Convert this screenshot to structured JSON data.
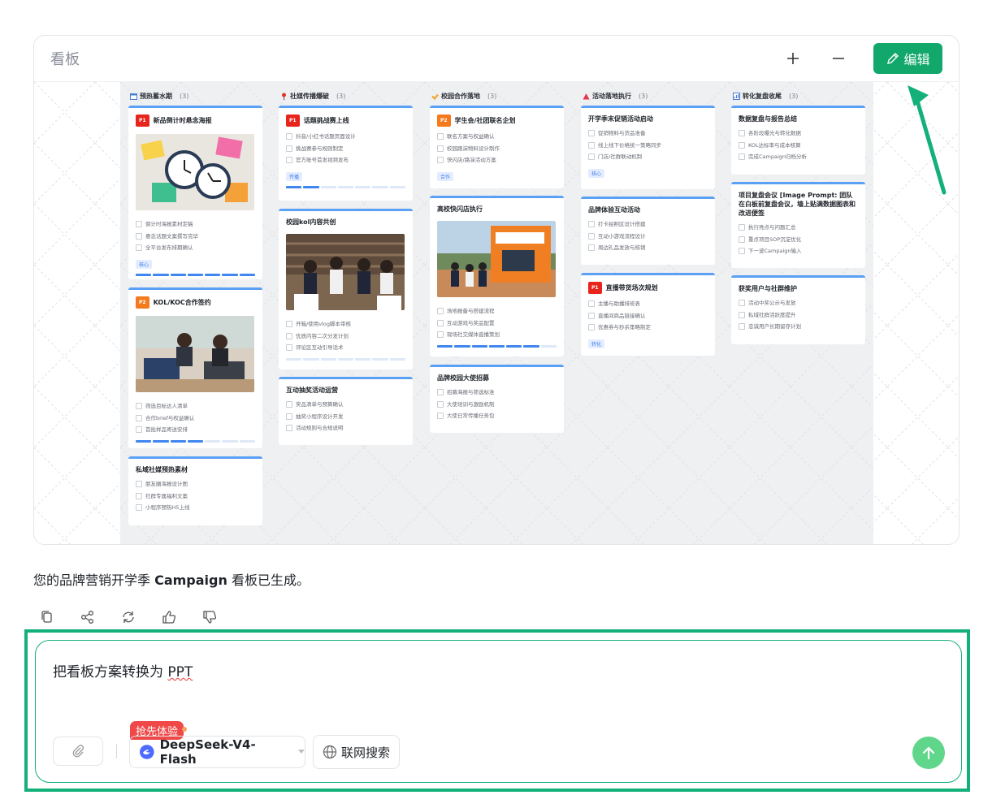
{
  "panel": {
    "title": "看板",
    "plus_icon": "plus-icon",
    "minus_icon": "minus-icon",
    "edit_label": "编辑"
  },
  "columns": [
    {
      "icon": "calendar-icon",
      "title": "预热蓄水期",
      "count": "(3)"
    },
    {
      "icon": "pin-icon",
      "title": "社媒传播爆破",
      "count": "(3)"
    },
    {
      "icon": "handshake-icon",
      "title": "校园合作落地",
      "count": "(3)"
    },
    {
      "icon": "tent-icon",
      "title": "活动落地执行",
      "count": "(3)"
    },
    {
      "icon": "chart-icon",
      "title": "转化复盘收尾",
      "count": "(3)"
    }
  ],
  "cards": {
    "c1a": {
      "priority": "P1",
      "title": "新品倒计时悬念海报",
      "items": [
        "倒计时海报素材定稿",
        "悬念话题文案撰写完毕",
        "全平台发布排期确认"
      ],
      "tag": "核心"
    },
    "c1b": {
      "priority": "P2",
      "title": "KOL/KOC合作签约",
      "items": [
        "筛选目标达人清单",
        "合作brief与权益确认",
        "首批样品寄送安排"
      ]
    },
    "c1c": {
      "title": "私域社媒预热素材",
      "items": [
        "朋友圈海报设计图",
        "社群专属福利文案",
        "小程序预热H5上线"
      ]
    },
    "c2a": {
      "priority": "P1",
      "title": "话题挑战赛上线",
      "items": [
        "抖音/小红书话题页面设计",
        "挑战赛参与规则制定",
        "官方账号首发视频发布"
      ],
      "tag": "传播"
    },
    "c2b": {
      "title": "校园kol内容共创",
      "items": [
        "开箱/使用vlog脚本审核",
        "优质内容二次分发计划",
        "评论区互动引导话术"
      ]
    },
    "c2c": {
      "title": "互动抽奖活动运营",
      "items": [
        "奖品清单与预算确认",
        "抽奖小程序设计开发",
        "活动规则与合规说明"
      ]
    },
    "c3a": {
      "priority": "P2",
      "title": "学生会/社团联名企划",
      "items": [
        "联名方案与权益确认",
        "校园路演物料设计制作",
        "快闪店/路演活动方案"
      ],
      "tag": "合作"
    },
    "c3b": {
      "title": "高校快闪店执行",
      "items": [
        "场地报备与搭建流程",
        "互动游戏与奖品配置",
        "现场社交媒体直播策划"
      ]
    },
    "c3c": {
      "title": "品牌校园大使招募",
      "items": [
        "招募海报与筛选标准",
        "大使培训与激励机制",
        "大使日常传播任务包"
      ]
    },
    "c4a": {
      "title": "开学季末促销活动启动",
      "items": [
        "促销物料与货品准备",
        "线上线下价格统一策略同步",
        "门店/社群联动机制"
      ],
      "tag": "核心"
    },
    "c4b": {
      "title": "品牌体验互动活动",
      "items": [
        "打卡拍照区设计搭建",
        "互动小游戏流程设计",
        "周边礼品发放与核销"
      ]
    },
    "c4c": {
      "priority": "P1",
      "title": "直播带货场次规划",
      "items": [
        "主播与助播排班表",
        "直播间商品链接确认",
        "优惠券与秒杀策略制定"
      ],
      "tag": "转化"
    },
    "c5a": {
      "title": "数据复盘与报告总结",
      "items": [
        "各阶段曝光与转化数据",
        "KOL达标率与成本核算",
        "完成Campaign归档分析"
      ]
    },
    "c5b": {
      "title": "项目复盘会议 [Image Prompt: 团队在白板前复盘会议，墙上贴满数据图表和改进便签",
      "items": [
        "执行亮点与问题汇总",
        "重点项目SOP沉淀优化",
        "下一波Campaign输入"
      ]
    },
    "c5c": {
      "title": "获奖用户与社群维护",
      "items": [
        "活动中奖公示与发放",
        "私域社群活跃度提升",
        "忠诚用户长期留存计划"
      ]
    }
  },
  "images": {
    "c1a": "photo-clocks-sticky-notes",
    "c1b": "photo-meeting-laptop-kol",
    "c2b": "photo-students-library",
    "c3b": "photo-campus-popup-store"
  },
  "progress": {
    "c1a": 1.0,
    "c1b": 0.5,
    "c2a": 0.3,
    "c2b": 0.0,
    "c3b": 0.86
  },
  "message": {
    "before": "您的品牌营销开学季 ",
    "bold": "Campaign",
    "after": " 看板已生成。"
  },
  "actions": [
    "copy-icon",
    "share-icon",
    "refresh-icon",
    "thumbs-up-icon",
    "thumbs-down-icon"
  ],
  "input": {
    "text_main": "把看板方案转换为 ",
    "text_flagged": "PPT",
    "badge": "抢先体验",
    "model": "DeepSeek-V4-Flash",
    "web_search": "联网搜索"
  },
  "colors": {
    "accent": "#12a86b",
    "highlight": "#14b07a",
    "p1": "#e8251c",
    "p2": "#f57a1d",
    "send": "#5fd68a"
  }
}
